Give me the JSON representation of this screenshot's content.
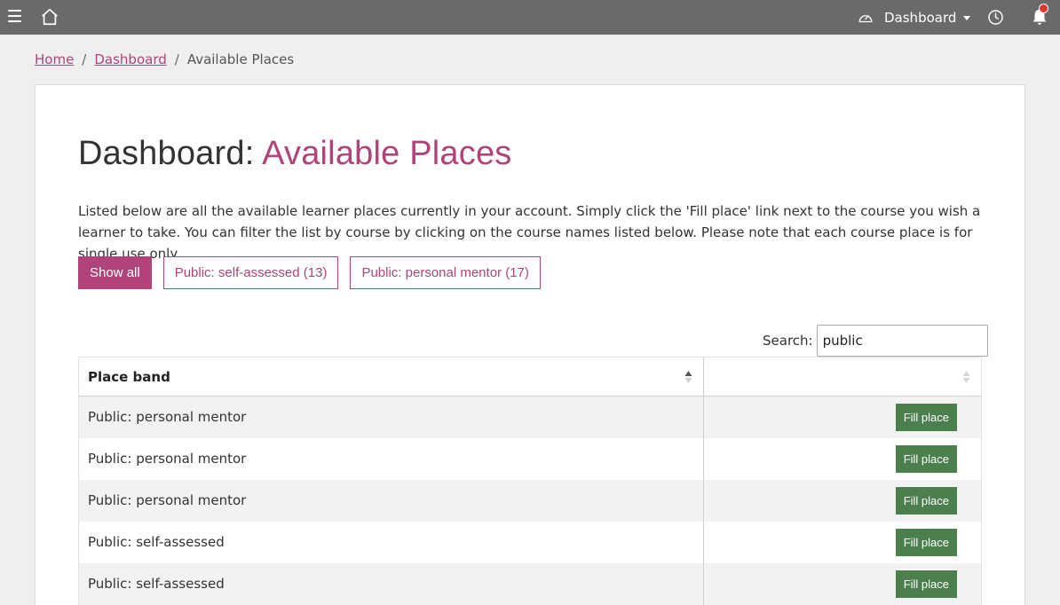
{
  "topbar": {
    "dashboard_label": "Dashboard",
    "icons": [
      "menu-icon",
      "home-icon",
      "gauge-icon",
      "chevron-down-icon",
      "clock-icon",
      "bell-icon"
    ]
  },
  "breadcrumb": {
    "home": "Home",
    "sep1": "/",
    "dashboard": "Dashboard",
    "sep2": "/",
    "current": "Available Places"
  },
  "page": {
    "title_prefix": "Dashboard:",
    "title_accent": "Available Places",
    "intro": "Listed below are all the available learner places currently in your account. Simply click the 'Fill place' link next to the course you wish a learner to take. You can filter the list by course by clicking on the course names listed below. Please note that each course place is for single use only."
  },
  "filters": [
    {
      "label": "Show all"
    },
    {
      "label": "Public: self-assessed (13)"
    },
    {
      "label": "Public: personal mentor (17)"
    }
  ],
  "search": {
    "label": "Search:",
    "value": "public"
  },
  "table": {
    "header": "Place band",
    "rows": [
      {
        "band": "Public: personal mentor",
        "action": "Fill place"
      },
      {
        "band": "Public: personal mentor",
        "action": "Fill place"
      },
      {
        "band": "Public: personal mentor",
        "action": "Fill place"
      },
      {
        "band": "Public: self-assessed",
        "action": "Fill place"
      },
      {
        "band": "Public: self-assessed",
        "action": "Fill place"
      }
    ]
  },
  "colors": {
    "topbar": "#6a6a6a",
    "accent": "#b0437a",
    "fill_button": "#4b7f4e",
    "notification": "#dd3333"
  }
}
